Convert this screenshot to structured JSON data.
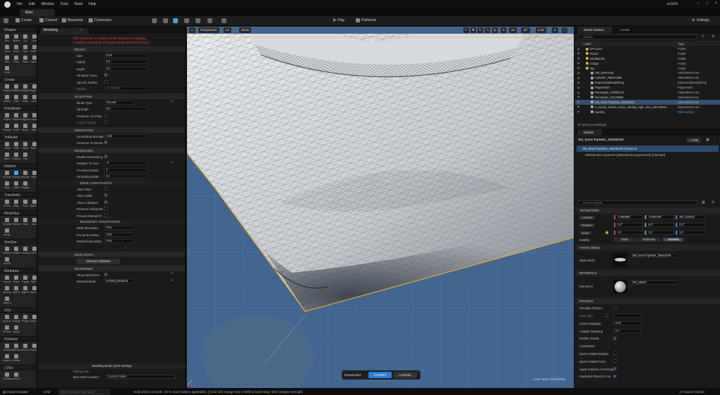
{
  "menubar": {
    "items": [
      "File",
      "Edit",
      "Window",
      "Tools",
      "Build",
      "Help"
    ],
    "project": "unSEA"
  },
  "tabs": {
    "main": "Main"
  },
  "toolbar": {
    "create": "Create",
    "content": "Content",
    "blueprints": "Blueprints",
    "cinematics": "Cinematics",
    "play": "Play",
    "platforms": "Platforms",
    "settings": "Settings"
  },
  "toolcats": [
    {
      "label": "Shapes",
      "tools": [
        "Box",
        "Sphere",
        "Cyl",
        "Cone",
        "Torus",
        "Arrow",
        "Rect",
        "RndRct",
        "Disc",
        "PDisc",
        "Stairs",
        "Capsule",
        "Circle"
      ]
    },
    {
      "label": "Create",
      "tools": [
        "PolyExt",
        "PathExt",
        "PathRev",
        "BdyRev",
        "Sweep",
        "Path",
        "Draw",
        "Cubic"
      ]
    },
    {
      "label": "PolyModel",
      "tools": [
        "PolyEd",
        "PolyDef",
        "EdgeIns",
        "LoopIns",
        "Extrude",
        "TriSel",
        "Bevel",
        "Build"
      ]
    },
    {
      "label": "TriModel",
      "tools": [
        "TriSel",
        "TriEd",
        "Weld",
        "PlnCut",
        "Mirror",
        "PolyCut",
        "Trim"
      ]
    },
    {
      "label": "Deform",
      "tools": [
        "VSculpt",
        "DSculpt",
        "Smooth",
        "Offset",
        "Warp",
        "Lattice",
        "Displace"
      ]
    },
    {
      "label": "Transform",
      "tools": [
        "XForm",
        "Align",
        "Pivot",
        "BakeRS"
      ]
    },
    {
      "label": "MeshOps",
      "tools": [
        "Simplify",
        "Remesh",
        "Weld",
        "Jacket",
        "Merge"
      ]
    },
    {
      "label": "VoxOps",
      "tools": [
        "VoxWrap",
        "VoxBlnd",
        "VoxMrg",
        "VoxPatch",
        "VoxFill"
      ]
    },
    {
      "label": "Attributes",
      "tools": [
        "Inspect",
        "Nrmls",
        "Tngnts",
        "AttrEd",
        "GenGrps",
        "GrpPnt",
        "WgtPnt",
        "MeshAt",
        "BakeTx"
      ]
    },
    {
      "label": "UVs",
      "tools": [
        "AutoUV",
        "Unwrap",
        "Project",
        "SeamEd",
        "XFormUV",
        "Layout"
      ]
    },
    {
      "label": "Volumes",
      "tools": [
        "VolToMsh",
        "MshToVol",
        "BSPConv",
        "PhysApx",
        "MakeVol",
        "CollMsh"
      ]
    },
    {
      "label": "LODs",
      "tools": [
        "LODMgr",
        "AutoLOD"
      ]
    }
  ],
  "modeling": {
    "tab": "Modeling",
    "warning": "This mesh has UV seams which may limit remeshing. Consider clearing the UV layers using the Remesh Tool.",
    "brush": {
      "title": "BRUSH",
      "size_label": "Size",
      "size": "8.00",
      "falloff_label": "Falloff",
      "falloff": "0.5",
      "depth_label": "Depth",
      "depth": "0.0",
      "hit_back_label": "Hit Back Faces",
      "specify_radius_label": "Specify Radius",
      "radius_label": "Radius",
      "radius": "12.788746"
    },
    "sculpting": {
      "title": "SCULPTING",
      "brush_type_label": "Brush Type",
      "brush_type": "Smooth",
      "strength_label": "Strength",
      "strength": "0.5",
      "preserve_uv_label": "Preserve UV Flow",
      "freeze_target_label": "Freeze Target"
    },
    "smoothing": {
      "title": "SMOOTHING",
      "smoothing_strength_label": "Smoothing Strength",
      "smoothing_strength": "0.25",
      "preserve_tri_label": "Preserve Tri Desns"
    },
    "remeshing": {
      "title": "REMESHING",
      "enable_label": "Enable Remeshing",
      "rel_tri_label": "Relative Tri Size",
      "rel_tri": "-5",
      "precision_label": "Precision Detail",
      "precision": "2",
      "smoothing_rate_label": "Smoothing Rate",
      "smoothing_rate": "0.1"
    },
    "edge": {
      "title": "EDGE CONSTRAINTS",
      "flips": "Allow Flips",
      "splits": "Allow Splits",
      "collapses": "Allow Collapses",
      "preserve_sharp": "Preserve Sharp Ed",
      "prevent_normal": "Prevent Normal Fl"
    },
    "boundary": {
      "title": "BOUNDARY CONSTRAINTS",
      "mesh_label": "Mesh Boundary",
      "mesh": "Free",
      "group_label": "Group Boundary",
      "group": "Free",
      "material_label": "Material Boundary",
      "material": "Free"
    },
    "mesh_edits": {
      "title": "MESH EDITS",
      "discard": "Discard Attributes"
    },
    "rendering": {
      "title": "RENDERING",
      "wireframe_label": "Show Wireframe",
      "material_mode_label": "Material Mode",
      "material_mode": "Existing Material"
    },
    "quick": {
      "title": "Modeling Mode Quick Settings",
      "editing_lod": "Editing LOD",
      "new_asset_label": "New Asset Location",
      "new_asset": "Current Folder"
    }
  },
  "viewport": {
    "perspective": "Perspective",
    "lit": "Lit",
    "show": "Show",
    "mode": "DynaSculpt",
    "accept": "ACCEPT",
    "cancel": "CANCEL",
    "level": "Level: Main (Persistent)",
    "snap1": "10",
    "snap2": "10°",
    "snap3": "0.25",
    "cam": "4"
  },
  "outliner": {
    "tab": "World Outliner",
    "tab2": "Levels",
    "search": "Search...",
    "col_label": "Label",
    "col_type": "Type",
    "rows": [
      {
        "name": "hProcess",
        "type": "Folder",
        "indent": 1,
        "kind": "folder"
      },
      {
        "name": "Rocks",
        "type": "Folder",
        "indent": 1,
        "kind": "folder"
      },
      {
        "name": "sandBorder",
        "type": "Folder",
        "indent": 1,
        "kind": "folder"
      },
      {
        "name": "Sndgrt",
        "type": "Folder",
        "indent": 1,
        "kind": "folder"
      },
      {
        "name": "Top",
        "type": "Folder",
        "indent": 1,
        "kind": "folder"
      },
      {
        "name": "SM_lanterCap",
        "type": "StaticMeshActor",
        "indent": 2,
        "kind": "mesh"
      },
      {
        "name": "Cylinder_7BB4A36B",
        "type": "StaticMeshActor",
        "indent": 2,
        "kind": "mesh"
      },
      {
        "name": "ExponentialHeightFog",
        "type": "ExponentialHeightFog",
        "indent": 2,
        "kind": "mesh"
      },
      {
        "name": "PlayerStart",
        "type": "PlayerStart",
        "indent": 2,
        "kind": "mesh"
      },
      {
        "name": "Rectangle_C809EC12",
        "type": "StaticMeshActor",
        "indent": 2,
        "kind": "mesh"
      },
      {
        "name": "Rectangle_C5476898",
        "type": "StaticMeshActor",
        "indent": 2,
        "kind": "mesh"
      },
      {
        "name": "SM_lanterTopMain_36646D09",
        "type": "StaticMeshActor",
        "indent": 2,
        "kind": "mesh",
        "selected": true
      },
      {
        "name": "S_Nordic_Beach_Rock_ukmlbq_high_Var1_59C4963A",
        "type": "StaticMeshActor",
        "indent": 2,
        "kind": "mesh"
      },
      {
        "name": "SunSky",
        "type": "Edit SunSky",
        "indent": 2,
        "kind": "mesh"
      }
    ],
    "actors": "57 actors (1 selected)"
  },
  "details": {
    "tab": "Details",
    "actor_name": "SM_lanterTopMain_36646D09",
    "add": "+ ADD",
    "instance": "SM_lanterTopMain_36646D09 (Instance)",
    "component": "StaticMeshComponent (StaticMeshComponent0) (Inherited)",
    "search": "Search Details",
    "transform": {
      "title": "TRANSFORM",
      "location_label": "Location",
      "location": [
        "-3.988984",
        "-8.686790",
        "451.318010"
      ],
      "rotation_label": "Rotation",
      "rotation": [
        "0.0°",
        "0.0°",
        "0.0°"
      ],
      "scale_label": "Scale",
      "scale": [
        "1.0",
        "1.0",
        "1.0"
      ],
      "mobility_label": "Mobility",
      "mobility": [
        "Static",
        "Stationary",
        "Movable"
      ]
    },
    "static_mesh": {
      "title": "STATIC MESH",
      "label": "Static Mesh",
      "value": "SM_lanterTopMain_36646D09"
    },
    "materials": {
      "title": "MATERIALS",
      "element": "Element 0",
      "value": "SM_plaster"
    },
    "physics": {
      "title": "PHYSICS",
      "simulate": "Simulate Physics",
      "mass": "Mass (kg)",
      "linear_damping": "Linear Damping",
      "linear_damping_val": "0.01",
      "angular_damping": "Angular Damping",
      "angular_damping_val": "0.0",
      "gravity": "Enable Gravity",
      "constraints": "Constraints",
      "ignore_radial_impulse": "Ignore Radial Impulse",
      "ignore_radial_force": "Ignore Radial Force",
      "apply_impulse": "Apply Impulse on Damage",
      "replicate": "Replicate Physics to Au"
    }
  },
  "status": {
    "content_drawer": "Content Drawer",
    "cmd": "Cmd",
    "cmd_placeholder": "Enter Console Command",
    "hint": "Hold Shift to Smooth, Ctrl to Invert (where applicable). [/] and S/D change Size (+Shift to small step). W/E changes Strength.",
    "source_control": "Source Control"
  }
}
